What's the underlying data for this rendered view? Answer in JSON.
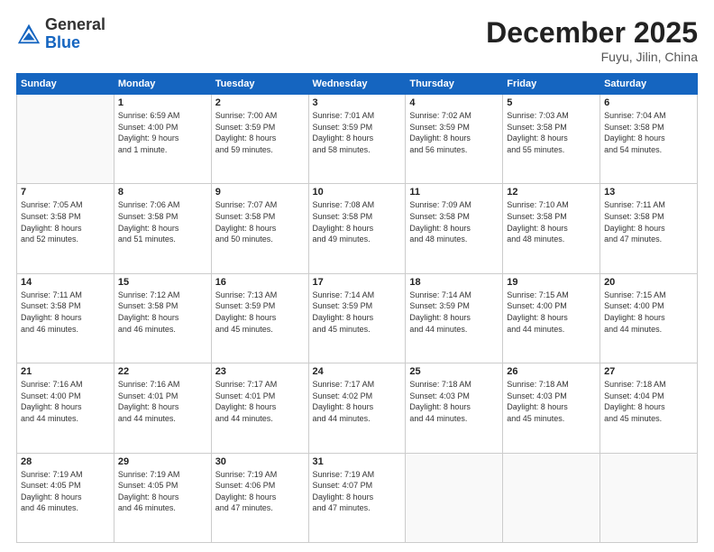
{
  "header": {
    "logo_general": "General",
    "logo_blue": "Blue",
    "title": "December 2025",
    "location": "Fuyu, Jilin, China"
  },
  "weekdays": [
    "Sunday",
    "Monday",
    "Tuesday",
    "Wednesday",
    "Thursday",
    "Friday",
    "Saturday"
  ],
  "weeks": [
    [
      {
        "day": "",
        "info": ""
      },
      {
        "day": "1",
        "info": "Sunrise: 6:59 AM\nSunset: 4:00 PM\nDaylight: 9 hours\nand 1 minute."
      },
      {
        "day": "2",
        "info": "Sunrise: 7:00 AM\nSunset: 3:59 PM\nDaylight: 8 hours\nand 59 minutes."
      },
      {
        "day": "3",
        "info": "Sunrise: 7:01 AM\nSunset: 3:59 PM\nDaylight: 8 hours\nand 58 minutes."
      },
      {
        "day": "4",
        "info": "Sunrise: 7:02 AM\nSunset: 3:59 PM\nDaylight: 8 hours\nand 56 minutes."
      },
      {
        "day": "5",
        "info": "Sunrise: 7:03 AM\nSunset: 3:58 PM\nDaylight: 8 hours\nand 55 minutes."
      },
      {
        "day": "6",
        "info": "Sunrise: 7:04 AM\nSunset: 3:58 PM\nDaylight: 8 hours\nand 54 minutes."
      }
    ],
    [
      {
        "day": "7",
        "info": "Sunrise: 7:05 AM\nSunset: 3:58 PM\nDaylight: 8 hours\nand 52 minutes."
      },
      {
        "day": "8",
        "info": "Sunrise: 7:06 AM\nSunset: 3:58 PM\nDaylight: 8 hours\nand 51 minutes."
      },
      {
        "day": "9",
        "info": "Sunrise: 7:07 AM\nSunset: 3:58 PM\nDaylight: 8 hours\nand 50 minutes."
      },
      {
        "day": "10",
        "info": "Sunrise: 7:08 AM\nSunset: 3:58 PM\nDaylight: 8 hours\nand 49 minutes."
      },
      {
        "day": "11",
        "info": "Sunrise: 7:09 AM\nSunset: 3:58 PM\nDaylight: 8 hours\nand 48 minutes."
      },
      {
        "day": "12",
        "info": "Sunrise: 7:10 AM\nSunset: 3:58 PM\nDaylight: 8 hours\nand 48 minutes."
      },
      {
        "day": "13",
        "info": "Sunrise: 7:11 AM\nSunset: 3:58 PM\nDaylight: 8 hours\nand 47 minutes."
      }
    ],
    [
      {
        "day": "14",
        "info": "Sunrise: 7:11 AM\nSunset: 3:58 PM\nDaylight: 8 hours\nand 46 minutes."
      },
      {
        "day": "15",
        "info": "Sunrise: 7:12 AM\nSunset: 3:58 PM\nDaylight: 8 hours\nand 46 minutes."
      },
      {
        "day": "16",
        "info": "Sunrise: 7:13 AM\nSunset: 3:59 PM\nDaylight: 8 hours\nand 45 minutes."
      },
      {
        "day": "17",
        "info": "Sunrise: 7:14 AM\nSunset: 3:59 PM\nDaylight: 8 hours\nand 45 minutes."
      },
      {
        "day": "18",
        "info": "Sunrise: 7:14 AM\nSunset: 3:59 PM\nDaylight: 8 hours\nand 44 minutes."
      },
      {
        "day": "19",
        "info": "Sunrise: 7:15 AM\nSunset: 4:00 PM\nDaylight: 8 hours\nand 44 minutes."
      },
      {
        "day": "20",
        "info": "Sunrise: 7:15 AM\nSunset: 4:00 PM\nDaylight: 8 hours\nand 44 minutes."
      }
    ],
    [
      {
        "day": "21",
        "info": "Sunrise: 7:16 AM\nSunset: 4:00 PM\nDaylight: 8 hours\nand 44 minutes."
      },
      {
        "day": "22",
        "info": "Sunrise: 7:16 AM\nSunset: 4:01 PM\nDaylight: 8 hours\nand 44 minutes."
      },
      {
        "day": "23",
        "info": "Sunrise: 7:17 AM\nSunset: 4:01 PM\nDaylight: 8 hours\nand 44 minutes."
      },
      {
        "day": "24",
        "info": "Sunrise: 7:17 AM\nSunset: 4:02 PM\nDaylight: 8 hours\nand 44 minutes."
      },
      {
        "day": "25",
        "info": "Sunrise: 7:18 AM\nSunset: 4:03 PM\nDaylight: 8 hours\nand 44 minutes."
      },
      {
        "day": "26",
        "info": "Sunrise: 7:18 AM\nSunset: 4:03 PM\nDaylight: 8 hours\nand 45 minutes."
      },
      {
        "day": "27",
        "info": "Sunrise: 7:18 AM\nSunset: 4:04 PM\nDaylight: 8 hours\nand 45 minutes."
      }
    ],
    [
      {
        "day": "28",
        "info": "Sunrise: 7:19 AM\nSunset: 4:05 PM\nDaylight: 8 hours\nand 46 minutes."
      },
      {
        "day": "29",
        "info": "Sunrise: 7:19 AM\nSunset: 4:05 PM\nDaylight: 8 hours\nand 46 minutes."
      },
      {
        "day": "30",
        "info": "Sunrise: 7:19 AM\nSunset: 4:06 PM\nDaylight: 8 hours\nand 47 minutes."
      },
      {
        "day": "31",
        "info": "Sunrise: 7:19 AM\nSunset: 4:07 PM\nDaylight: 8 hours\nand 47 minutes."
      },
      {
        "day": "",
        "info": ""
      },
      {
        "day": "",
        "info": ""
      },
      {
        "day": "",
        "info": ""
      }
    ]
  ]
}
